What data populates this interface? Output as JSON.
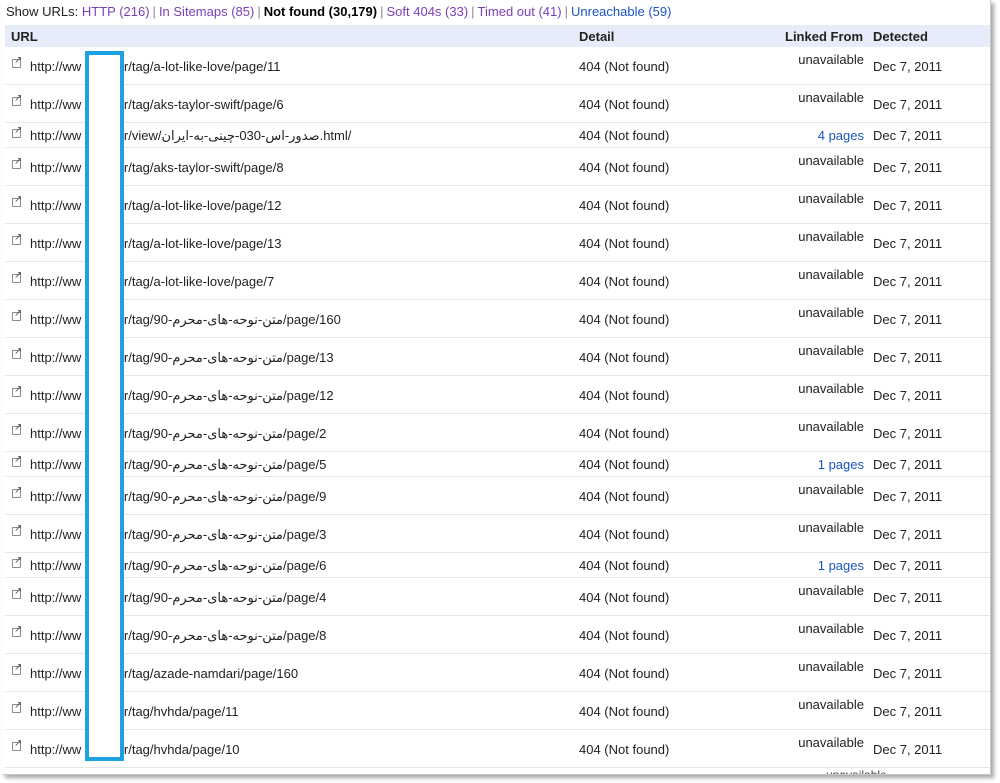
{
  "filters": {
    "prefix": "Show URLs:",
    "items": [
      {
        "label": "HTTP (216)",
        "active": false
      },
      {
        "label": "In Sitemaps (85)",
        "active": false
      },
      {
        "label": "Not found (30,179)",
        "active": true
      },
      {
        "label": "Soft 404s (33)",
        "active": false
      },
      {
        "label": "Timed out (41)",
        "active": false
      },
      {
        "label": "Unreachable (59)",
        "active": false
      }
    ]
  },
  "table": {
    "headers": {
      "url": "URL",
      "detail": "Detail",
      "linked_from": "Linked From",
      "detected": "Detected"
    },
    "rows": [
      {
        "url_left": "http://ww",
        "url_right": "ir/tag/a-lot-like-love/page/11",
        "detail": "404 (Not found)",
        "linked": "unavailable",
        "detected": "Dec 7, 2011"
      },
      {
        "url_left": "http://ww",
        "url_right": "ir/tag/aks-taylor-swift/page/6",
        "detail": "404 (Not found)",
        "linked": "unavailable",
        "detected": "Dec 7, 2011"
      },
      {
        "url_left": "http://ww",
        "url_right": "ir/view/صدور-اس-030-چینی-به-ایران.html/",
        "detail": "404 (Not found)",
        "linked": "4 pages",
        "detected": "Dec 7, 2011"
      },
      {
        "url_left": "http://ww",
        "url_right": "ir/tag/aks-taylor-swift/page/8",
        "detail": "404 (Not found)",
        "linked": "unavailable",
        "detected": "Dec 7, 2011"
      },
      {
        "url_left": "http://ww",
        "url_right": "ir/tag/a-lot-like-love/page/12",
        "detail": "404 (Not found)",
        "linked": "unavailable",
        "detected": "Dec 7, 2011"
      },
      {
        "url_left": "http://ww",
        "url_right": "ir/tag/a-lot-like-love/page/13",
        "detail": "404 (Not found)",
        "linked": "unavailable",
        "detected": "Dec 7, 2011"
      },
      {
        "url_left": "http://ww",
        "url_right": "ir/tag/a-lot-like-love/page/7",
        "detail": "404 (Not found)",
        "linked": "unavailable",
        "detected": "Dec 7, 2011"
      },
      {
        "url_left": "http://ww",
        "url_right": "ir/tag/90-متن-نوحه-های-محرم/page/160",
        "detail": "404 (Not found)",
        "linked": "unavailable",
        "detected": "Dec 7, 2011"
      },
      {
        "url_left": "http://ww",
        "url_right": "ir/tag/90-متن-نوحه-های-محرم/page/13",
        "detail": "404 (Not found)",
        "linked": "unavailable",
        "detected": "Dec 7, 2011"
      },
      {
        "url_left": "http://ww",
        "url_right": "ir/tag/90-متن-نوحه-های-محرم/page/12",
        "detail": "404 (Not found)",
        "linked": "unavailable",
        "detected": "Dec 7, 2011"
      },
      {
        "url_left": "http://ww",
        "url_right": "ir/tag/90-متن-نوحه-های-محرم/page/2",
        "detail": "404 (Not found)",
        "linked": "unavailable",
        "detected": "Dec 7, 2011"
      },
      {
        "url_left": "http://ww",
        "url_right": "ir/tag/90-متن-نوحه-های-محرم/page/5",
        "detail": "404 (Not found)",
        "linked": "1 pages",
        "detected": "Dec 7, 2011"
      },
      {
        "url_left": "http://ww",
        "url_right": "ir/tag/90-متن-نوحه-های-محرم/page/9",
        "detail": "404 (Not found)",
        "linked": "unavailable",
        "detected": "Dec 7, 2011"
      },
      {
        "url_left": "http://ww",
        "url_right": "ir/tag/90-متن-نوحه-های-محرم/page/3",
        "detail": "404 (Not found)",
        "linked": "unavailable",
        "detected": "Dec 7, 2011"
      },
      {
        "url_left": "http://ww",
        "url_right": "ir/tag/90-متن-نوحه-های-محرم/page/6",
        "detail": "404 (Not found)",
        "linked": "1 pages",
        "detected": "Dec 7, 2011"
      },
      {
        "url_left": "http://ww",
        "url_right": "ir/tag/90-متن-نوحه-های-محرم/page/4",
        "detail": "404 (Not found)",
        "linked": "unavailable",
        "detected": "Dec 7, 2011"
      },
      {
        "url_left": "http://ww",
        "url_right": "ir/tag/90-متن-نوحه-های-محرم/page/8",
        "detail": "404 (Not found)",
        "linked": "unavailable",
        "detected": "Dec 7, 2011"
      },
      {
        "url_left": "http://ww",
        "url_right": "ir/tag/azade-namdari/page/160",
        "detail": "404 (Not found)",
        "linked": "unavailable",
        "detected": "Dec 7, 2011"
      },
      {
        "url_left": "http://ww",
        "url_right": "ir/tag/hvhda/page/11",
        "detail": "404 (Not found)",
        "linked": "unavailable",
        "detected": "Dec 7, 2011"
      },
      {
        "url_left": "http://ww",
        "url_right": "ir/tag/hvhda/page/10",
        "detail": "404 (Not found)",
        "linked": "unavailable",
        "detected": "Dec 7, 2011"
      }
    ],
    "cut_off_text": "unavailable"
  },
  "colors": {
    "link_purple": "#7b3fb5",
    "link_blue": "#1a55c0",
    "header_bg": "#e6ecf9",
    "redaction_border": "#1ea1e0"
  }
}
